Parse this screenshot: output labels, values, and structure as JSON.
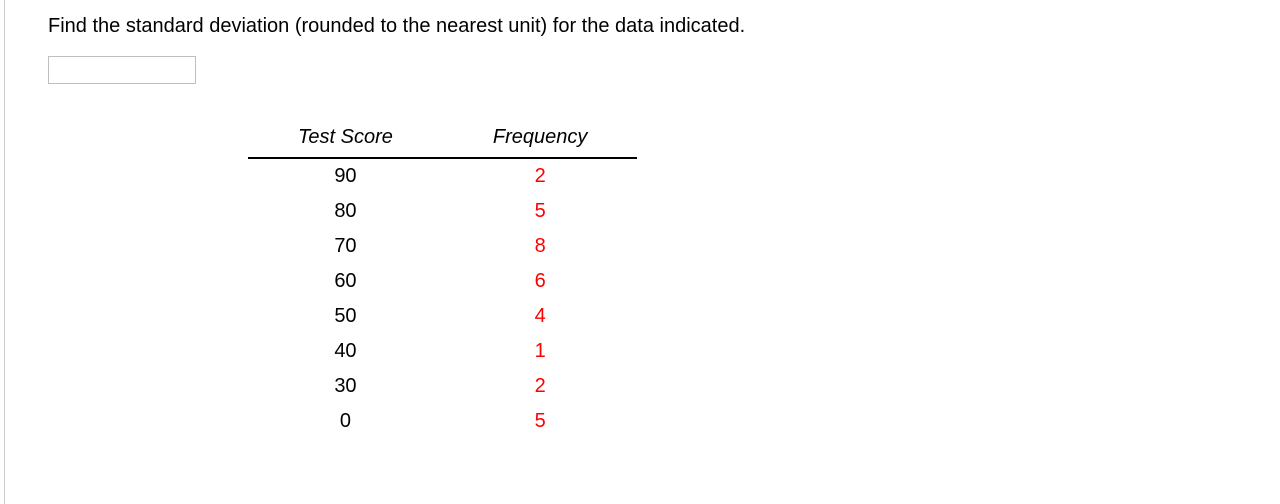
{
  "question": "Find the standard deviation (rounded to the nearest unit) for the data indicated.",
  "answer_value": "",
  "table": {
    "headers": {
      "score": "Test Score",
      "frequency": "Frequency"
    },
    "rows": [
      {
        "score": "90",
        "frequency": "2"
      },
      {
        "score": "80",
        "frequency": "5"
      },
      {
        "score": "70",
        "frequency": "8"
      },
      {
        "score": "60",
        "frequency": "6"
      },
      {
        "score": "50",
        "frequency": "4"
      },
      {
        "score": "40",
        "frequency": "1"
      },
      {
        "score": "30",
        "frequency": "2"
      },
      {
        "score": "0",
        "frequency": "5"
      }
    ]
  }
}
